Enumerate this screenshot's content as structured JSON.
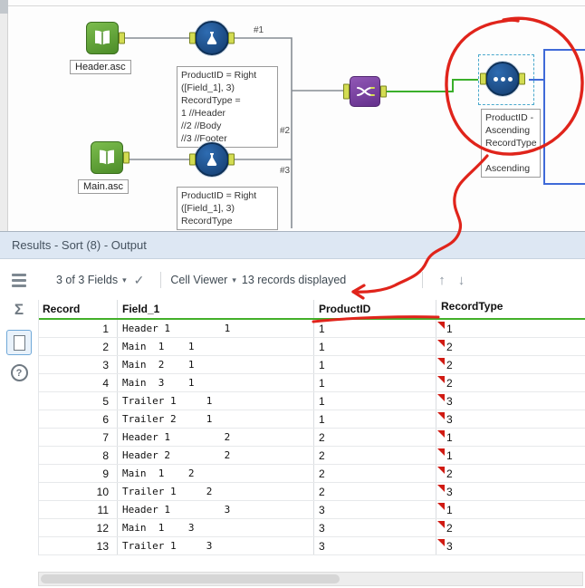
{
  "canvas": {
    "input_header": {
      "label": "Header.asc"
    },
    "input_main": {
      "label": "Main.asc"
    },
    "formula_top_annotation": "ProductID = Right\n([Field_1], 3)\nRecordType =\n1 //Header\n//2 //Body\n//3 //Footer",
    "formula_bottom_annotation": "ProductID = Right\n([Field_1], 3)\nRecordType",
    "sort_annotation": "ProductID -\nAscending\nRecordType -\nAscending",
    "connection_labels": {
      "c1": "#1",
      "c2": "#2",
      "c3": "#3"
    }
  },
  "results": {
    "title": "Results - Sort (8) - Output",
    "toolbar": {
      "fields_summary": "3 of 3 Fields",
      "cell_viewer_label": "Cell Viewer",
      "records_displayed": "13 records displayed"
    },
    "table": {
      "columns": [
        "Record",
        "Field_1",
        "ProductID",
        "RecordType"
      ],
      "rows": [
        {
          "record": "1",
          "field_1": "Header 1         1",
          "product_id": "1",
          "record_type": "1"
        },
        {
          "record": "2",
          "field_1": "Main  1    1",
          "product_id": "1",
          "record_type": "2"
        },
        {
          "record": "3",
          "field_1": "Main  2    1",
          "product_id": "1",
          "record_type": "2"
        },
        {
          "record": "4",
          "field_1": "Main  3    1",
          "product_id": "1",
          "record_type": "2"
        },
        {
          "record": "5",
          "field_1": "Trailer 1     1",
          "product_id": "1",
          "record_type": "3"
        },
        {
          "record": "6",
          "field_1": "Trailer 2     1",
          "product_id": "1",
          "record_type": "3"
        },
        {
          "record": "7",
          "field_1": "Header 1         2",
          "product_id": "2",
          "record_type": "1"
        },
        {
          "record": "8",
          "field_1": "Header 2         2",
          "product_id": "2",
          "record_type": "1"
        },
        {
          "record": "9",
          "field_1": "Main  1    2",
          "product_id": "2",
          "record_type": "2"
        },
        {
          "record": "10",
          "field_1": "Trailer 1     2",
          "product_id": "2",
          "record_type": "3"
        },
        {
          "record": "11",
          "field_1": "Header 1         3",
          "product_id": "3",
          "record_type": "1"
        },
        {
          "record": "12",
          "field_1": "Main  1    3",
          "product_id": "3",
          "record_type": "2"
        },
        {
          "record": "13",
          "field_1": "Trailer 1     3",
          "product_id": "3",
          "record_type": "3"
        }
      ]
    }
  },
  "icons": {
    "caret": "▾",
    "check": "✓",
    "up_arrow": "↑",
    "down_arrow": "↓",
    "question": "?",
    "sigma": "Σ"
  },
  "colors": {
    "annotation_red": "#e0241b",
    "connection_blue": "#3f6ad8",
    "connection_green": "#3aaf2b",
    "connection_gray": "#868d94",
    "header_underline_green": "#43b02a",
    "cell_flag_red": "#d11a12"
  }
}
